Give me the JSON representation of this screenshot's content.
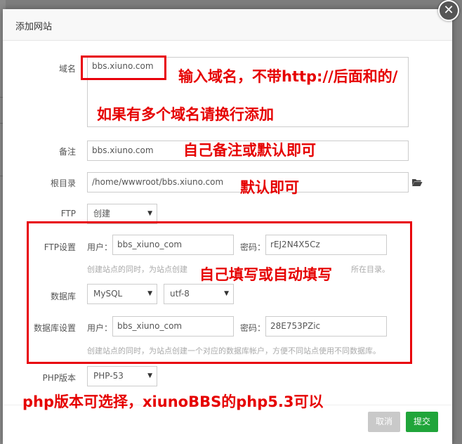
{
  "dialog": {
    "title": "添加网站",
    "close_glyph": "✕"
  },
  "form": {
    "domain": {
      "label": "域名",
      "value": "bbs.xiuno.com"
    },
    "remark": {
      "label": "备注",
      "value": "bbs.xiuno.com"
    },
    "root": {
      "label": "根目录",
      "value": "/home/wwwroot/bbs.xiuno.com"
    },
    "ftp": {
      "label": "FTP",
      "selected": "创建"
    },
    "ftp_settings": {
      "label": "FTP设置",
      "user_label": "用户：",
      "user_value": "bbs_xiuno_com",
      "password_label": "密码：",
      "password_value": "rEJ2N4X5Cz",
      "hint": "创建站点的同时，为站点创建",
      "hint_tail": "所在目录。"
    },
    "database": {
      "label": "数据库",
      "type_selected": "MySQL",
      "charset_selected": "utf-8"
    },
    "db_settings": {
      "label": "数据库设置",
      "user_label": "用户：",
      "user_value": "bbs_xiuno_com",
      "password_label": "密码：",
      "password_value": "28E753PZic",
      "hint": "创建站点的同时，为站点创建一个对应的数据库帐户，方便不同站点使用不同数据库。"
    },
    "php": {
      "label": "PHP版本",
      "selected": "PHP-53"
    }
  },
  "buttons": {
    "cancel": "取消",
    "submit": "提交"
  },
  "annotations": {
    "domain_note": "输入域名，不带http://后面和的/",
    "multi_domain_note": "如果有多个域名请换行添加",
    "remark_note": "自己备注或默认即可",
    "root_note": "默认即可",
    "ftp_note": "自己填写或自动填写",
    "php_note": "php版本可选择，xiunoBBS的php5.3可以"
  },
  "icons": {
    "folder": "folder-open-icon",
    "caret": "caret-down-icon",
    "close": "close-icon"
  },
  "colors": {
    "annotation": "#e60000",
    "submit": "#20a53a",
    "cancel": "#c9c9c9"
  }
}
